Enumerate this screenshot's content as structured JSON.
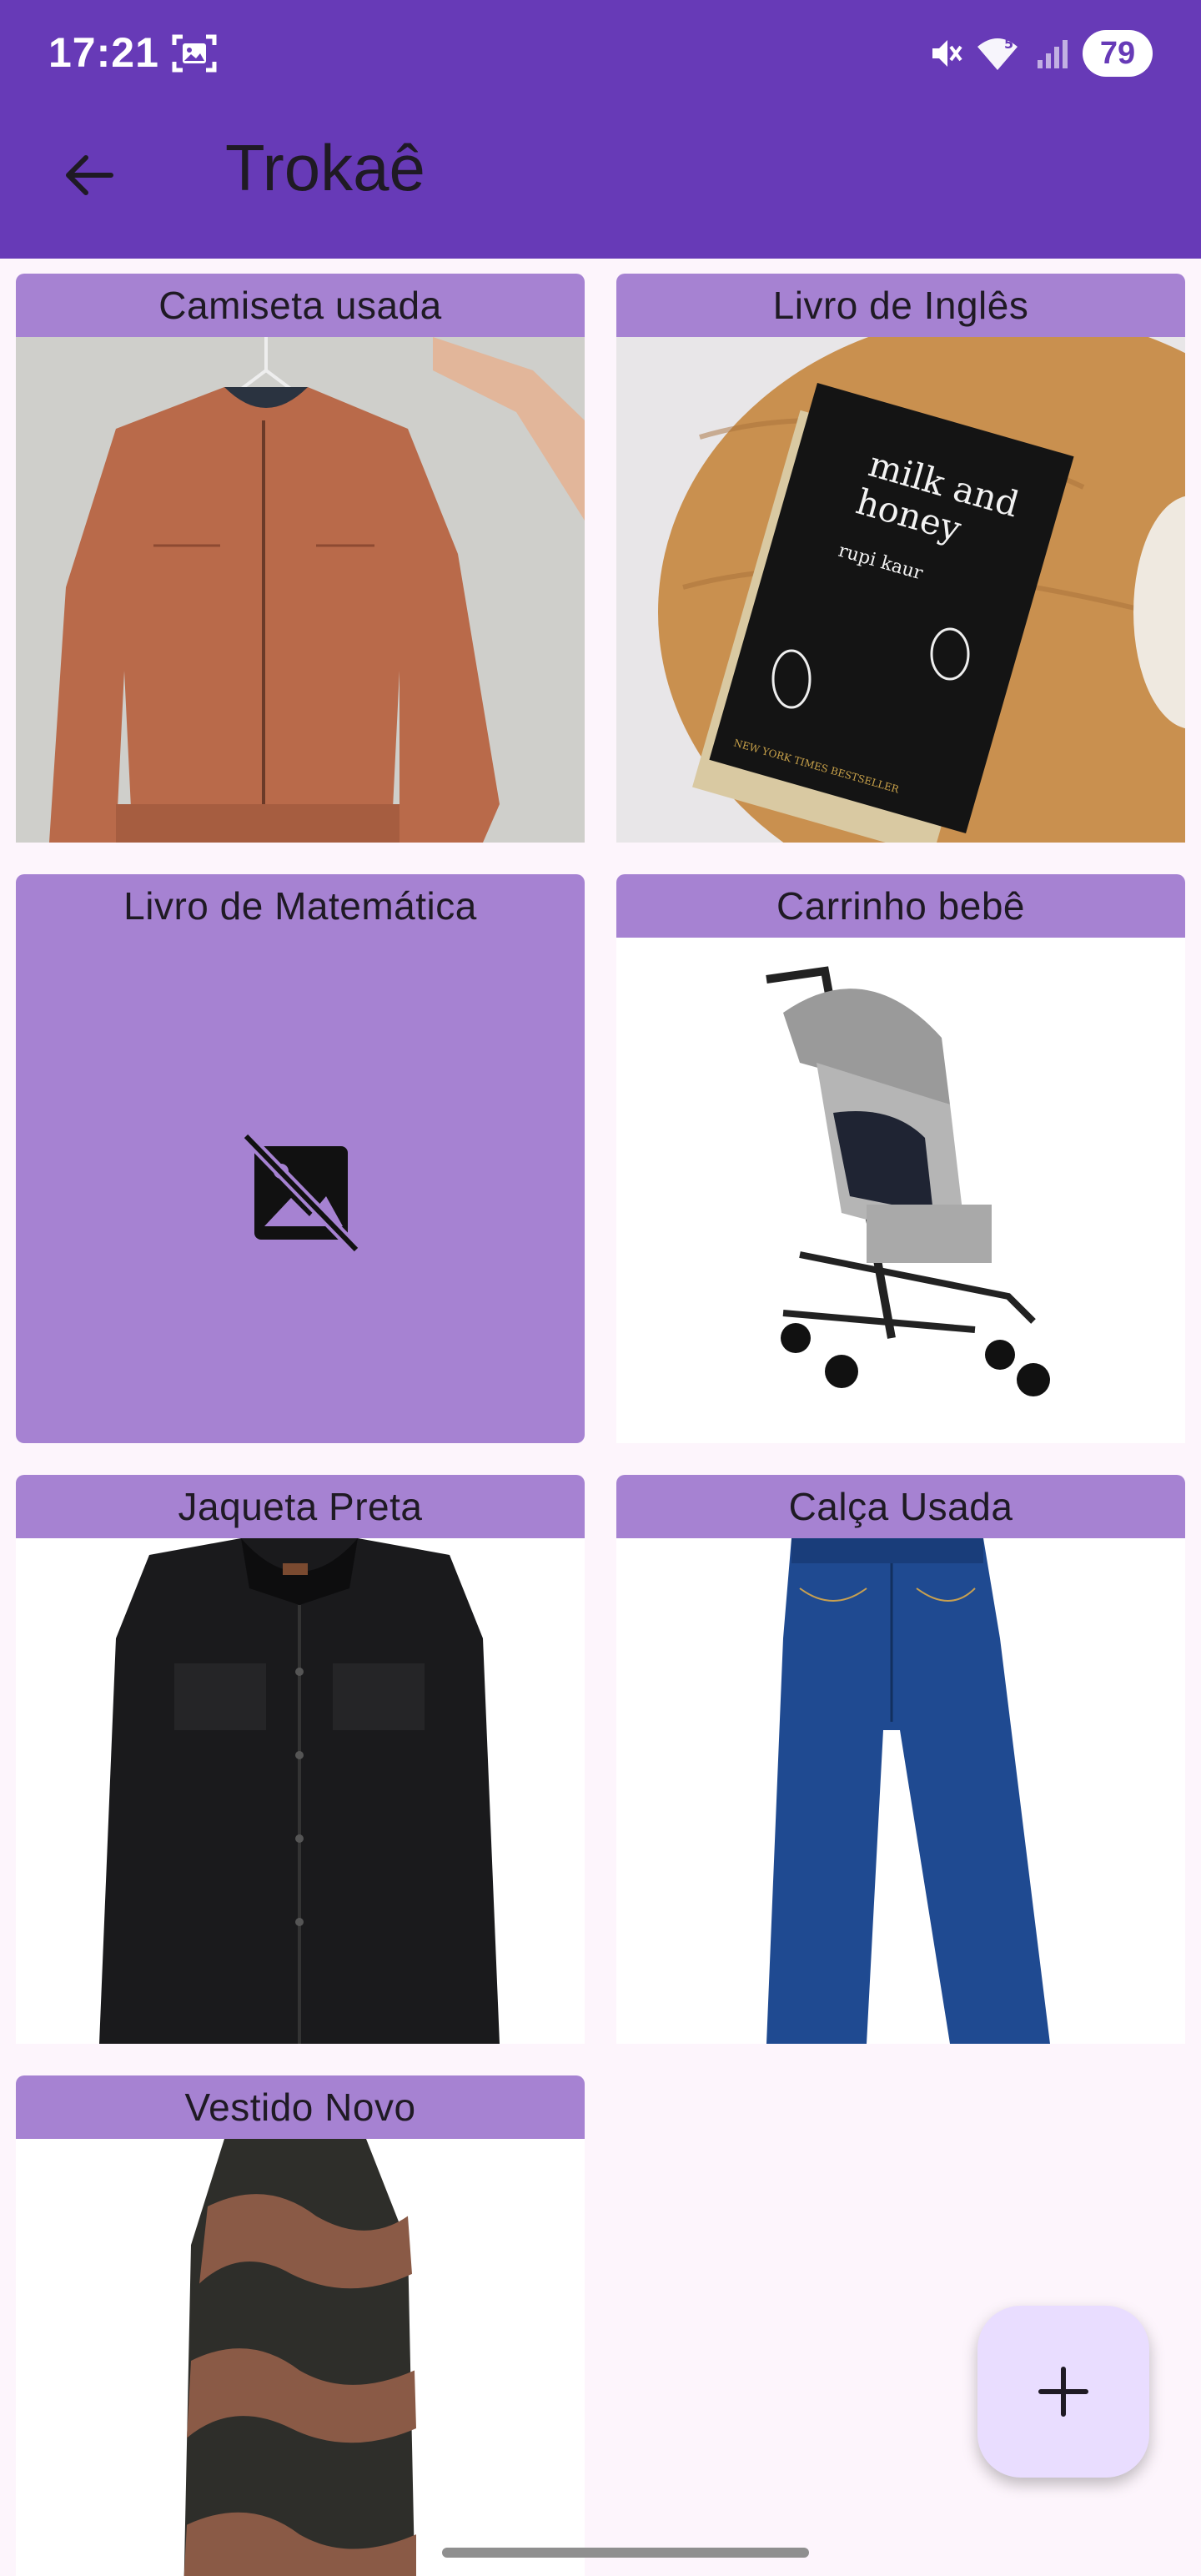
{
  "status_bar": {
    "time": "17:21",
    "battery": "79",
    "icons": [
      "screenshot-icon",
      "mute-icon",
      "wifi-icon",
      "signal-icon"
    ]
  },
  "app_bar": {
    "title": "Trokaê",
    "back_icon": "arrow-back-icon",
    "color": "#673ab7"
  },
  "items": [
    {
      "title": "Camiseta usada",
      "image": "orange-jacket-photo"
    },
    {
      "title": "Livro de Inglês",
      "image": "book-milk-and-honey-photo",
      "image_text": {
        "line1": "milk and",
        "line2": "honey",
        "author": "rupi kaur",
        "tag": "NEW YORK TIMES BESTSELLER"
      }
    },
    {
      "title": "Livro de Matemática",
      "image": "broken-image-icon"
    },
    {
      "title": "Carrinho bebê",
      "image": "stroller-photo"
    },
    {
      "title": "Jaqueta Preta",
      "image": "black-jacket-photo"
    },
    {
      "title": "Calça Usada",
      "image": "jeans-photo"
    },
    {
      "title": "Vestido Novo",
      "image": "dress-photo"
    }
  ],
  "fab": {
    "icon": "plus-icon",
    "color": "#e9ddff"
  },
  "accent_colors": {
    "card_title": "#a682d2",
    "background": "#fdf5fc"
  }
}
